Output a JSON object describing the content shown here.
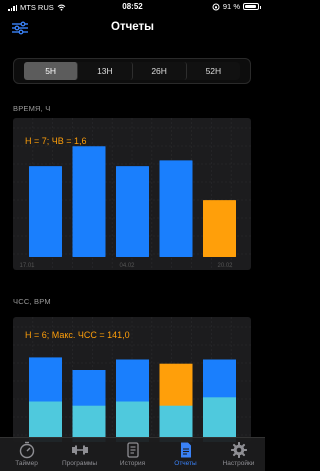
{
  "status_bar": {
    "carrier": "MTS RUS",
    "time": "08:52",
    "battery_percent": "91 %"
  },
  "nav": {
    "title": "Отчеты",
    "menu_icon": "sliders-icon"
  },
  "segmented": {
    "options": [
      "5Н",
      "13Н",
      "26Н",
      "52Н"
    ],
    "selected": "5Н"
  },
  "section_time": {
    "label": "ВРЕМЯ, Ч"
  },
  "section_hr": {
    "label": "ЧСС, BPM"
  },
  "chart_data": [
    {
      "type": "bar",
      "annotation": "Н = 7; ЧВ = 1,6",
      "x_tick_labels": [
        "17.01",
        "04.02",
        "20.02"
      ],
      "categories": [
        "1",
        "2",
        "3",
        "4",
        "5"
      ],
      "values": [
        1.6,
        1.95,
        1.6,
        1.7,
        1.0
      ],
      "colors": [
        "#1a7ffd",
        "#1a7ffd",
        "#1a7ffd",
        "#1a7ffd",
        "#ff9f0a"
      ],
      "ylim": [
        0,
        2.2
      ],
      "grid": true
    },
    {
      "type": "bar",
      "annotation": "Н = 6; Макс. ЧСС = 141,0",
      "categories": [
        "1",
        "2",
        "3",
        "4",
        "5"
      ],
      "series": [
        {
          "values": [
            120,
            118,
            120,
            118,
            122
          ],
          "color": "#4fc9dd"
        },
        {
          "values": [
            141,
            135,
            140,
            138,
            140
          ],
          "color": "#1a7ffd"
        }
      ],
      "highlight_index": 3,
      "highlight_color": "#ff9f0a",
      "ylim": [
        0,
        160
      ],
      "grid": true
    }
  ],
  "tabs": [
    {
      "label": "Таймер",
      "icon": "timer-icon",
      "active": false
    },
    {
      "label": "Программы",
      "icon": "dumbbell-icon",
      "active": false
    },
    {
      "label": "История",
      "icon": "history-icon",
      "active": false
    },
    {
      "label": "Отчеты",
      "icon": "report-icon",
      "active": true
    },
    {
      "label": "Настройки",
      "icon": "gear-icon",
      "active": false
    }
  ]
}
